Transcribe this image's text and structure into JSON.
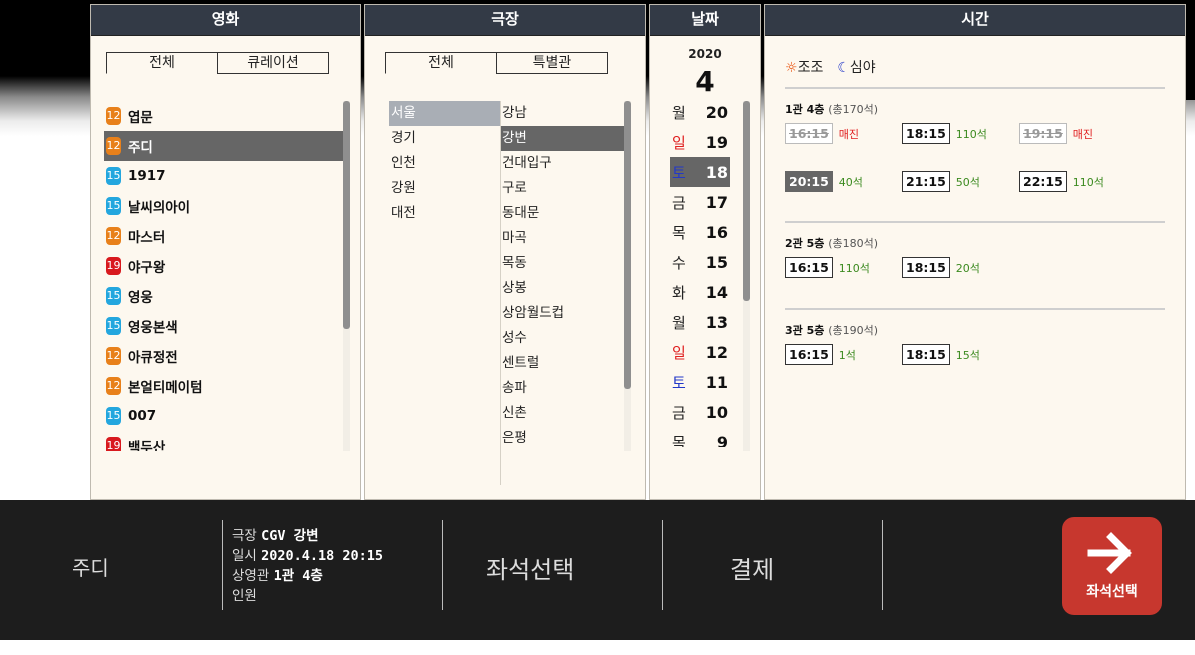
{
  "panels": {
    "movie": {
      "title": "영화",
      "tabs": [
        "전체",
        "큐레이션"
      ],
      "items": [
        {
          "rating": "12",
          "color": "#e8801a",
          "title": "엽문"
        },
        {
          "rating": "12",
          "color": "#e8801a",
          "title": "주디",
          "selected": true
        },
        {
          "rating": "15",
          "color": "#23a6de",
          "title": "1917"
        },
        {
          "rating": "15",
          "color": "#23a6de",
          "title": "날씨의아이"
        },
        {
          "rating": "12",
          "color": "#e8801a",
          "title": "마스터"
        },
        {
          "rating": "19",
          "color": "#d8191e",
          "title": "야구왕"
        },
        {
          "rating": "15",
          "color": "#23a6de",
          "title": "영웅"
        },
        {
          "rating": "15",
          "color": "#23a6de",
          "title": "영웅본색"
        },
        {
          "rating": "12",
          "color": "#e8801a",
          "title": "아큐정전"
        },
        {
          "rating": "12",
          "color": "#e8801a",
          "title": "본얼티메이텀"
        },
        {
          "rating": "15",
          "color": "#23a6de",
          "title": "007"
        },
        {
          "rating": "19",
          "color": "#d8191e",
          "title": "백두산"
        }
      ]
    },
    "theater": {
      "title": "극장",
      "tabs": [
        "전체",
        "특별관"
      ],
      "regions": [
        "서울",
        "경기",
        "인천",
        "강원",
        "대전"
      ],
      "selected_region": "서울",
      "theaters": [
        "강남",
        "강변",
        "건대입구",
        "구로",
        "동대문",
        "마곡",
        "목동",
        "상봉",
        "상암월드컵",
        "성수",
        "센트럴",
        "송파",
        "신촌",
        "은평"
      ],
      "selected_theater": "강변"
    },
    "date": {
      "title": "날짜",
      "year": "2020",
      "month": "4",
      "days": [
        {
          "dow": "월",
          "num": "20",
          "type": "weekday"
        },
        {
          "dow": "일",
          "num": "19",
          "type": "sun"
        },
        {
          "dow": "토",
          "num": "18",
          "type": "sat",
          "selected": true
        },
        {
          "dow": "금",
          "num": "17",
          "type": "weekday"
        },
        {
          "dow": "목",
          "num": "16",
          "type": "weekday"
        },
        {
          "dow": "수",
          "num": "15",
          "type": "weekday"
        },
        {
          "dow": "화",
          "num": "14",
          "type": "weekday"
        },
        {
          "dow": "월",
          "num": "13",
          "type": "weekday"
        },
        {
          "dow": "일",
          "num": "12",
          "type": "sun"
        },
        {
          "dow": "토",
          "num": "11",
          "type": "sat"
        },
        {
          "dow": "금",
          "num": "10",
          "type": "weekday"
        },
        {
          "dow": "목",
          "num": "9",
          "type": "weekday"
        }
      ]
    },
    "time": {
      "title": "시간",
      "legend": {
        "morning": "조조",
        "night": "심야"
      },
      "halls": [
        {
          "name": "1관 4층",
          "capacity": "(총170석)",
          "slots": [
            {
              "time": "16:15",
              "seats": "매진",
              "status": "sold"
            },
            {
              "time": "18:15",
              "seats": "110석",
              "status": "open"
            },
            {
              "time": "19:15",
              "seats": "매진",
              "status": "sold"
            },
            {
              "time": "20:15",
              "seats": "40석",
              "status": "selected"
            },
            {
              "time": "21:15",
              "seats": "50석",
              "status": "open"
            },
            {
              "time": "22:15",
              "seats": "110석",
              "status": "open"
            }
          ]
        },
        {
          "name": "2관 5층",
          "capacity": "(총180석)",
          "slots": [
            {
              "time": "16:15",
              "seats": "110석",
              "status": "open"
            },
            {
              "time": "18:15",
              "seats": "20석",
              "status": "open"
            }
          ]
        },
        {
          "name": "3관 5층",
          "capacity": "(총190석)",
          "slots": [
            {
              "time": "16:15",
              "seats": "1석",
              "status": "open"
            },
            {
              "time": "18:15",
              "seats": "15석",
              "status": "open"
            }
          ]
        }
      ]
    }
  },
  "summary": {
    "movie": "주디",
    "info": {
      "theater_label": "극장",
      "theater_value": "CGV 강변",
      "datetime_label": "일시",
      "datetime_value": "2020.4.18 20:15",
      "hall_label": "상영관",
      "hall_value": "1관 4층",
      "people_label": "인원",
      "people_value": ""
    },
    "step_seat": "좌석선택",
    "step_pay": "결제",
    "next_button": "좌석선택"
  },
  "colors": {
    "accent": "#c7372e",
    "header": "#333a46",
    "selected": "#666666"
  }
}
